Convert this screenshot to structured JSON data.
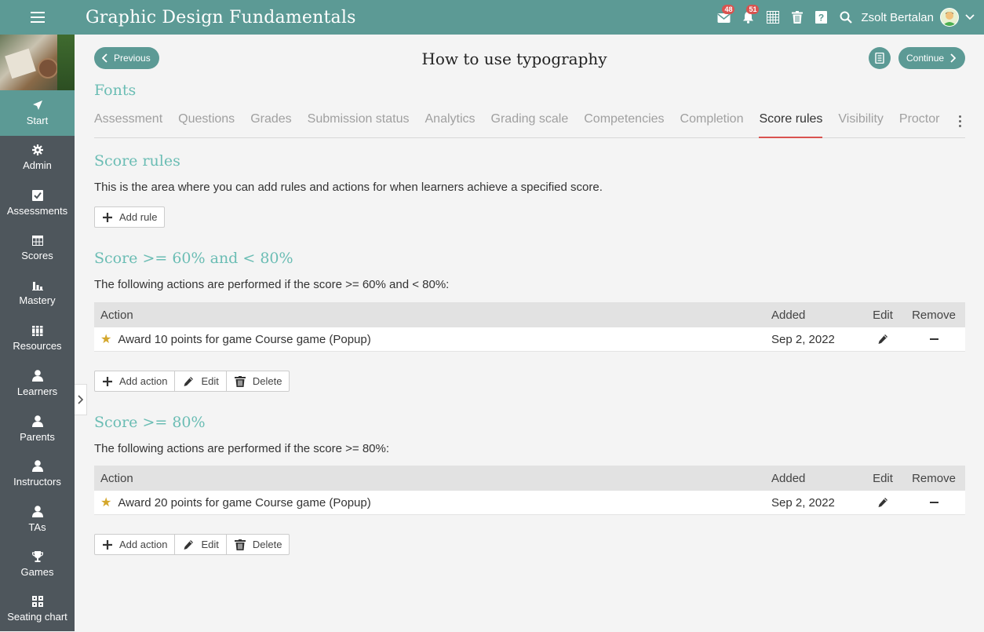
{
  "header": {
    "app_title": "Graphic Design Fundamentals",
    "messages_badge": "48",
    "notifications_badge": "51",
    "user_name": "Zsolt Bertalan"
  },
  "sidebar": {
    "items": [
      {
        "label": "Start",
        "icon": "paper-plane-icon",
        "active": true
      },
      {
        "label": "Admin",
        "icon": "gear-icon"
      },
      {
        "label": "Assessments",
        "icon": "checkbox-icon"
      },
      {
        "label": "Scores",
        "icon": "grid-icon"
      },
      {
        "label": "Mastery",
        "icon": "bar-chart-icon"
      },
      {
        "label": "Resources",
        "icon": "books-icon"
      },
      {
        "label": "Learners",
        "icon": "person-icon"
      },
      {
        "label": "Parents",
        "icon": "person-icon"
      },
      {
        "label": "Instructors",
        "icon": "person-icon"
      },
      {
        "label": "TAs",
        "icon": "person-icon"
      },
      {
        "label": "Games",
        "icon": "trophy-icon"
      },
      {
        "label": "Seating chart",
        "icon": "seating-icon"
      }
    ]
  },
  "nav": {
    "previous_label": "Previous",
    "continue_label": "Continue"
  },
  "page": {
    "title": "How to use typography",
    "section": "Fonts"
  },
  "tabs": [
    {
      "label": "Assessment"
    },
    {
      "label": "Questions"
    },
    {
      "label": "Grades"
    },
    {
      "label": "Submission status"
    },
    {
      "label": "Analytics"
    },
    {
      "label": "Grading scale"
    },
    {
      "label": "Competencies"
    },
    {
      "label": "Completion"
    },
    {
      "label": "Score rules",
      "active": true
    },
    {
      "label": "Visibility"
    },
    {
      "label": "Proctor"
    }
  ],
  "score_rules": {
    "title": "Score rules",
    "description": "This is the area where you can add rules and actions for when learners achieve a specified score.",
    "add_rule_label": "Add rule"
  },
  "table_headers": {
    "action": "Action",
    "added": "Added",
    "edit": "Edit",
    "remove": "Remove"
  },
  "rules": [
    {
      "title": "Score >= 60% and < 80%",
      "description": "The following actions are performed if the score >= 60% and < 80%:",
      "rows": [
        {
          "action": "Award 10 points for game Course game (Popup)",
          "added": "Sep 2, 2022"
        }
      ]
    },
    {
      "title": "Score >= 80%",
      "description": "The following actions are performed if the score >= 80%:",
      "rows": [
        {
          "action": "Award 20 points for game Course game (Popup)",
          "added": "Sep 2, 2022"
        }
      ]
    }
  ],
  "rule_buttons": {
    "add_action": "Add action",
    "edit": "Edit",
    "delete": "Delete"
  },
  "colors": {
    "brand": "#5c9a95",
    "heading": "#6bbdb4",
    "sidebar": "#4e565c",
    "badge": "#d9534f",
    "star": "#d4a72c"
  }
}
